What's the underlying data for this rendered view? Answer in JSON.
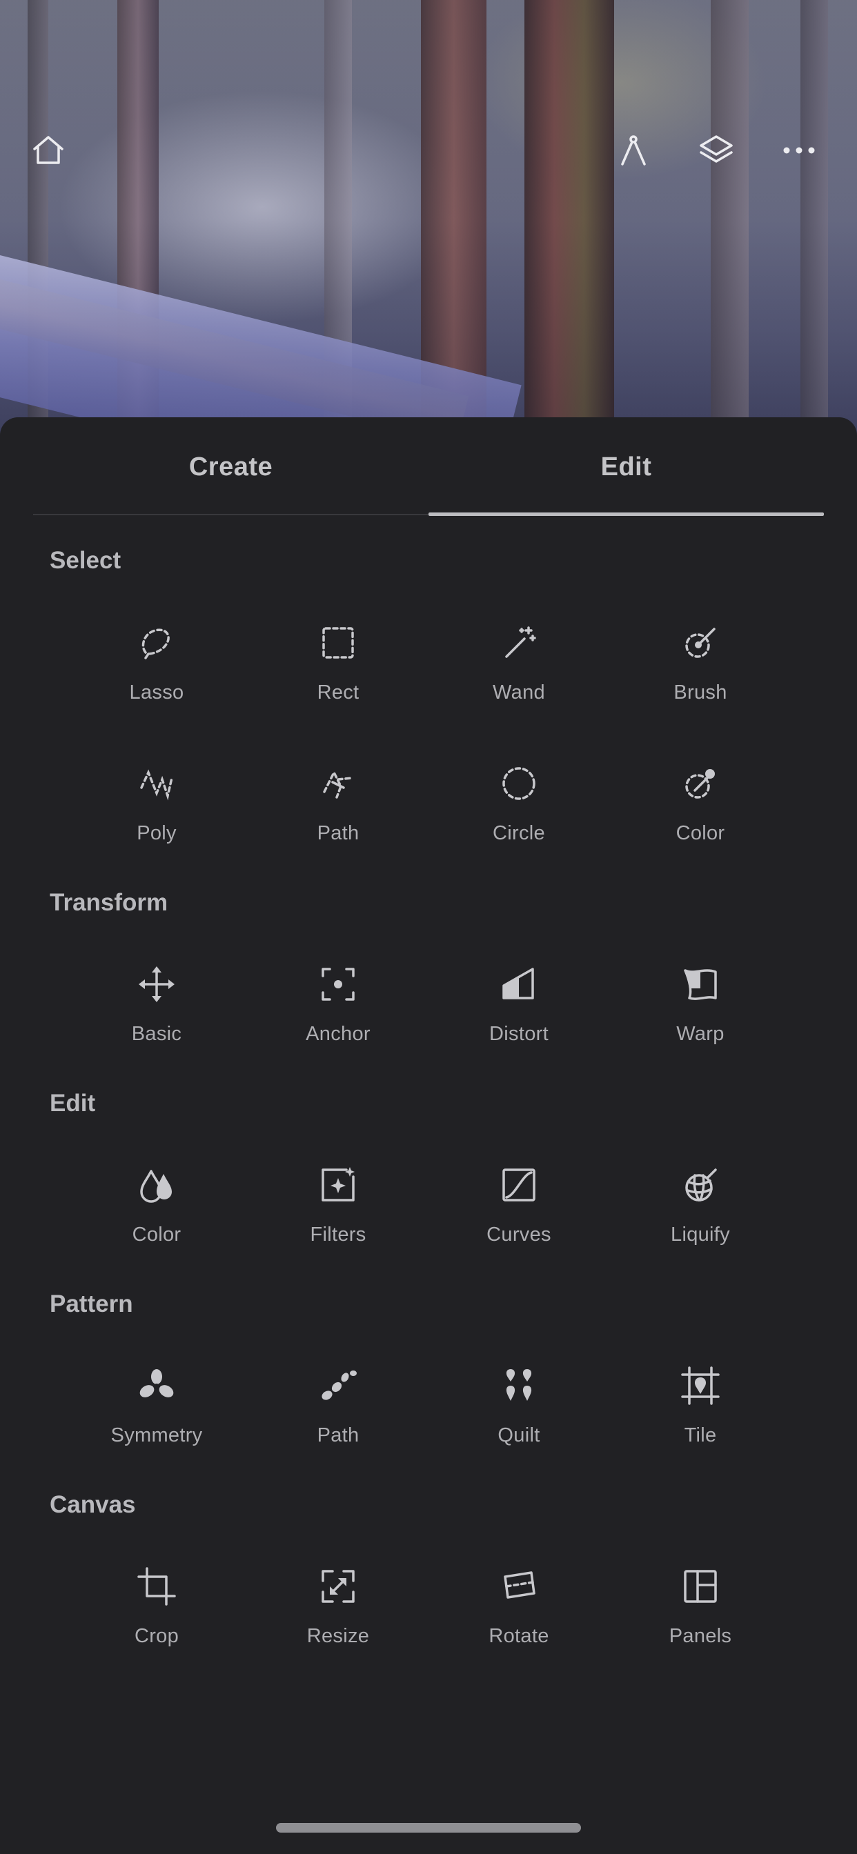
{
  "toolbar": {
    "home_icon": "home-icon",
    "ruler_icon": "compass-icon",
    "layers_icon": "layers-icon",
    "more_icon": "more-dots-icon"
  },
  "tabs": [
    {
      "label": "Create",
      "active": false
    },
    {
      "label": "Edit",
      "active": true
    }
  ],
  "sections": [
    {
      "title": "Select",
      "tools": [
        {
          "label": "Lasso",
          "icon": "lasso-icon"
        },
        {
          "label": "Rect",
          "icon": "rect-select-icon"
        },
        {
          "label": "Wand",
          "icon": "magic-wand-icon"
        },
        {
          "label": "Brush",
          "icon": "brush-select-icon"
        },
        {
          "label": "Poly",
          "icon": "poly-select-icon"
        },
        {
          "label": "Path",
          "icon": "path-select-icon"
        },
        {
          "label": "Circle",
          "icon": "circle-select-icon"
        },
        {
          "label": "Color",
          "icon": "color-select-icon"
        }
      ]
    },
    {
      "title": "Transform",
      "tools": [
        {
          "label": "Basic",
          "icon": "move-icon"
        },
        {
          "label": "Anchor",
          "icon": "anchor-icon"
        },
        {
          "label": "Distort",
          "icon": "distort-icon"
        },
        {
          "label": "Warp",
          "icon": "warp-icon"
        }
      ]
    },
    {
      "title": "Edit",
      "tools": [
        {
          "label": "Color",
          "icon": "color-drops-icon"
        },
        {
          "label": "Filters",
          "icon": "filters-icon"
        },
        {
          "label": "Curves",
          "icon": "curves-icon"
        },
        {
          "label": "Liquify",
          "icon": "liquify-icon"
        }
      ]
    },
    {
      "title": "Pattern",
      "tools": [
        {
          "label": "Symmetry",
          "icon": "symmetry-icon"
        },
        {
          "label": "Path",
          "icon": "pattern-path-icon"
        },
        {
          "label": "Quilt",
          "icon": "quilt-icon"
        },
        {
          "label": "Tile",
          "icon": "tile-icon"
        }
      ]
    },
    {
      "title": "Canvas",
      "tools": [
        {
          "label": "Crop",
          "icon": "crop-icon"
        },
        {
          "label": "Resize",
          "icon": "resize-icon"
        },
        {
          "label": "Rotate",
          "icon": "rotate-icon"
        },
        {
          "label": "Panels",
          "icon": "panels-icon"
        }
      ]
    }
  ]
}
